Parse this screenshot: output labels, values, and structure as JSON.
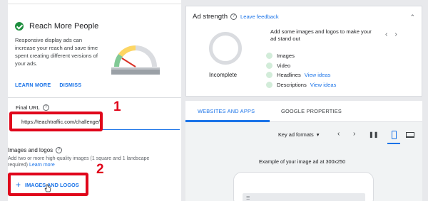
{
  "reach_card": {
    "title": "Reach More People",
    "body": "Responsive display ads can increase your reach and save time spent creating different versions of your ads.",
    "learn_more": "LEARN MORE",
    "dismiss": "DISMISS"
  },
  "final_url": {
    "label": "Final URL",
    "value": "https://teachtraffic.com/challenge/|"
  },
  "images_logos": {
    "label": "Images and logos",
    "description": "Add two or more high-quality images (1 square and 1 landscape required)",
    "learn_more": "Learn more",
    "button_label": "IMAGES AND LOGOS"
  },
  "annotations": {
    "step1": "1",
    "step2": "2",
    "highlight_color": "#e0061b"
  },
  "ad_strength": {
    "title": "Ad strength",
    "leave_feedback": "Leave feedback",
    "status": "Incomplete",
    "message": "Add some images and logos to make your ad stand out",
    "checklist": [
      {
        "label": "Images",
        "link": ""
      },
      {
        "label": "Video",
        "link": ""
      },
      {
        "label": "Headlines",
        "link": "View ideas"
      },
      {
        "label": "Descriptions",
        "link": "View ideas"
      }
    ]
  },
  "preview": {
    "tabs": [
      {
        "label": "WEBSITES AND APPS"
      },
      {
        "label": "GOOGLE PROPERTIES"
      }
    ],
    "format_select": "Key ad formats",
    "caption": "Example of your image ad at 300x250"
  },
  "colors": {
    "accent": "#1a73e8",
    "success": "#1e8e3e"
  }
}
